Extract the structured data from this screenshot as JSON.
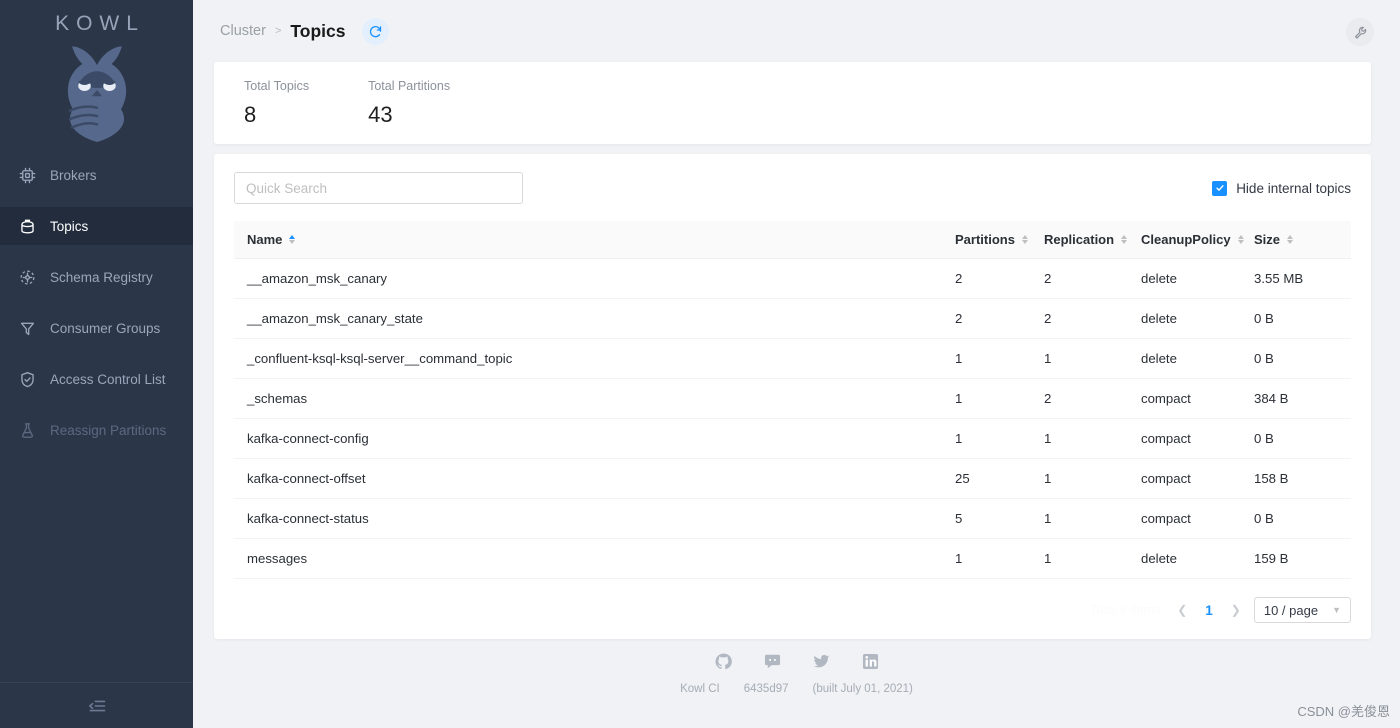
{
  "sidebar": {
    "logo_text": "KOWL",
    "items": [
      {
        "label": "Brokers",
        "icon": "chip-icon",
        "active": false,
        "disabled": false
      },
      {
        "label": "Topics",
        "icon": "database-icon",
        "active": true,
        "disabled": false
      },
      {
        "label": "Schema Registry",
        "icon": "hub-icon",
        "active": false,
        "disabled": false
      },
      {
        "label": "Consumer Groups",
        "icon": "funnel-icon",
        "active": false,
        "disabled": false
      },
      {
        "label": "Access Control List",
        "icon": "shield-check-icon",
        "active": false,
        "disabled": false
      },
      {
        "label": "Reassign Partitions",
        "icon": "flask-icon",
        "active": false,
        "disabled": true
      }
    ],
    "collapse_icon": "menu-fold-icon"
  },
  "header": {
    "breadcrumb_parent": "Cluster",
    "breadcrumb_separator": ">",
    "breadcrumb_current": "Topics",
    "refresh_icon": "refresh-icon",
    "tool_icon": "wrench-icon"
  },
  "stats": [
    {
      "label": "Total Topics",
      "value": "8"
    },
    {
      "label": "Total Partitions",
      "value": "43"
    }
  ],
  "filters": {
    "search_placeholder": "Quick Search",
    "search_value": "",
    "hide_internal_label": "Hide internal topics",
    "hide_internal_checked": true
  },
  "table": {
    "columns": [
      {
        "label": "Name",
        "sorted": "asc"
      },
      {
        "label": "Partitions",
        "sorted": "none"
      },
      {
        "label": "Replication",
        "sorted": "none"
      },
      {
        "label": "CleanupPolicy",
        "sorted": "none"
      },
      {
        "label": "Size",
        "sorted": "none"
      }
    ],
    "rows": [
      {
        "name": "__amazon_msk_canary",
        "partitions": "2",
        "replication": "2",
        "cleanup": "delete",
        "size": "3.55 MB"
      },
      {
        "name": "__amazon_msk_canary_state",
        "partitions": "2",
        "replication": "2",
        "cleanup": "delete",
        "size": "0 B"
      },
      {
        "name": "_confluent-ksql-ksql-server__command_topic",
        "partitions": "1",
        "replication": "1",
        "cleanup": "delete",
        "size": "0 B"
      },
      {
        "name": "_schemas",
        "partitions": "1",
        "replication": "2",
        "cleanup": "compact",
        "size": "384 B"
      },
      {
        "name": "kafka-connect-config",
        "partitions": "1",
        "replication": "1",
        "cleanup": "compact",
        "size": "0 B"
      },
      {
        "name": "kafka-connect-offset",
        "partitions": "25",
        "replication": "1",
        "cleanup": "compact",
        "size": "158 B"
      },
      {
        "name": "kafka-connect-status",
        "partitions": "5",
        "replication": "1",
        "cleanup": "compact",
        "size": "0 B"
      },
      {
        "name": "messages",
        "partitions": "1",
        "replication": "1",
        "cleanup": "delete",
        "size": "159 B"
      }
    ]
  },
  "pagination": {
    "total_text": "Total 8 items",
    "prev_icon": "chevron-left-icon",
    "next_icon": "chevron-right-icon",
    "current_page": "1",
    "page_size_label": "10 / page"
  },
  "footer": {
    "social": [
      "github-icon",
      "discord-icon",
      "twitter-icon",
      "linkedin-icon"
    ],
    "build_name": "Kowl CI",
    "build_sha": "6435d97",
    "build_date": "(built July 01, 2021)"
  },
  "watermark": "CSDN @羌俊恩",
  "colors": {
    "sidebar_bg": "#2b3649",
    "sidebar_active": "#222c3d",
    "accent": "#1890ff",
    "page_bg": "#f0f2f5"
  }
}
